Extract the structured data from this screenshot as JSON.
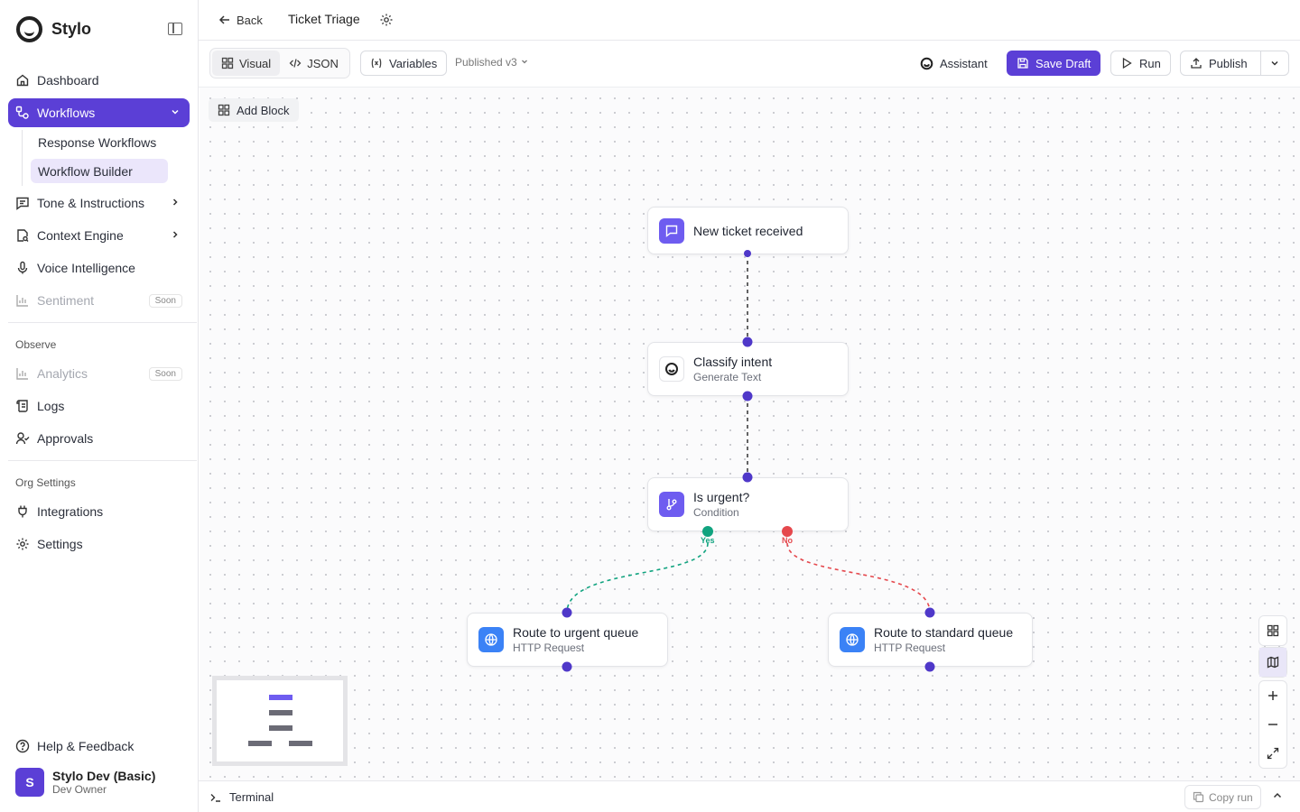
{
  "app": {
    "name": "Stylo"
  },
  "sidebar": {
    "dashboard": "Dashboard",
    "workflows": "Workflows",
    "workflows_sub": [
      "Response Workflows",
      "Workflow Builder"
    ],
    "tone": "Tone & Instructions",
    "context": "Context Engine",
    "voice": "Voice Intelligence",
    "sentiment": "Sentiment",
    "soon": "Soon",
    "observe_label": "Observe",
    "analytics": "Analytics",
    "logs": "Logs",
    "approvals": "Approvals",
    "org_label": "Org Settings",
    "integrations": "Integrations",
    "settings": "Settings",
    "help": "Help & Feedback",
    "user": {
      "initial": "S",
      "name": "Stylo Dev (Basic)",
      "role": "Dev Owner"
    }
  },
  "header": {
    "back": "Back",
    "title": "Ticket Triage"
  },
  "toolbar": {
    "visual": "Visual",
    "json": "JSON",
    "variables": "Variables",
    "published": "Published v3",
    "assistant": "Assistant",
    "save_draft": "Save Draft",
    "run": "Run",
    "publish": "Publish"
  },
  "canvas": {
    "add_block": "Add Block",
    "nodes": [
      {
        "title": "New ticket received",
        "subtitle": ""
      },
      {
        "title": "Classify intent",
        "subtitle": "Generate Text"
      },
      {
        "title": "Is urgent?",
        "subtitle": "Condition"
      },
      {
        "title": "Route to urgent queue",
        "subtitle": "HTTP Request"
      },
      {
        "title": "Route to standard queue",
        "subtitle": "HTTP Request"
      }
    ],
    "branch_yes": "Yes",
    "branch_no": "No",
    "colors": {
      "accent": "#5b3fd6",
      "yes": "#10a37f",
      "no": "#e5484d",
      "port": "#4f38c9"
    }
  },
  "terminal": {
    "label": "Terminal",
    "copy_run": "Copy run"
  }
}
